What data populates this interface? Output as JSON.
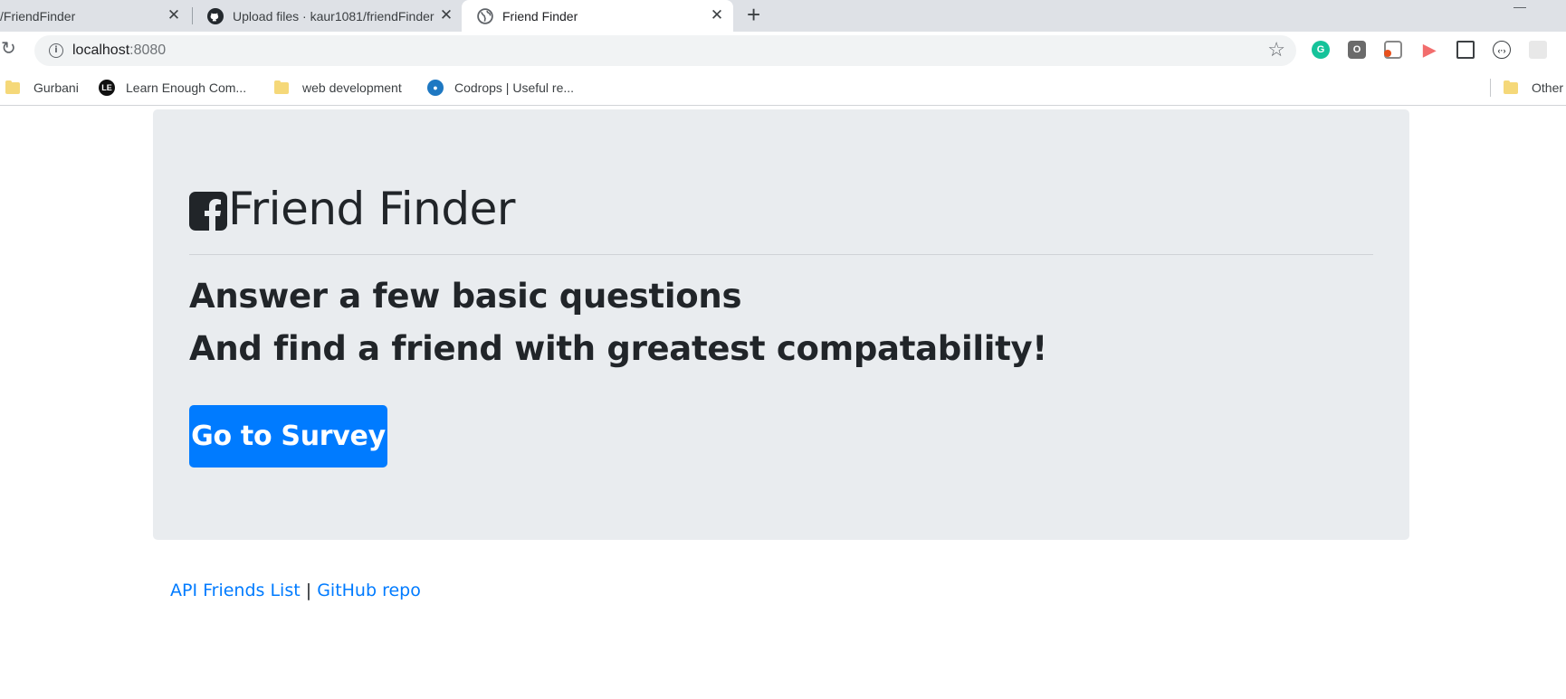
{
  "browser": {
    "tabs": [
      {
        "title": "/FriendFinder",
        "icon": "document-icon",
        "active": false
      },
      {
        "title": "Upload files · kaur1081/friendFinder",
        "icon": "github-icon",
        "active": false
      },
      {
        "title": "Friend Finder",
        "icon": "globe-icon",
        "active": true
      }
    ],
    "address": {
      "host": "localhost",
      "port": ":8080"
    },
    "bookmarks": [
      {
        "label": "Gurbani",
        "icon": "folder-icon"
      },
      {
        "label": "Learn Enough Com...",
        "icon": "learn-enough-icon"
      },
      {
        "label": "web development",
        "icon": "folder-icon"
      },
      {
        "label": "Codrops | Useful re...",
        "icon": "codrops-icon"
      },
      {
        "label": "Other",
        "icon": "folder-icon"
      }
    ],
    "extensions": [
      "grammarly-icon",
      "extension-o-icon",
      "office-icon",
      "arrow-extension-icon",
      "screenshot-icon",
      "code-extension-icon",
      "extension-gray-icon"
    ]
  },
  "page": {
    "title": "Friend Finder",
    "lead1": "Answer a few basic questions",
    "lead2": "And find a friend with greatest compatability!",
    "button": "Go to Survey",
    "footer": {
      "link1": "API Friends List",
      "separator": "|",
      "link2": "GitHub repo"
    }
  },
  "colors": {
    "primary": "#007bff",
    "jumbotron_bg": "#e9ecef",
    "text": "#212529"
  }
}
